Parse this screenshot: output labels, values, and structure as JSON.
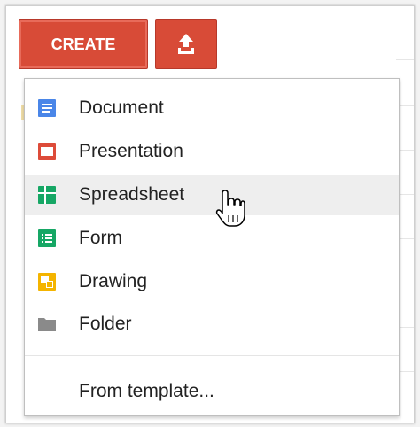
{
  "toolbar": {
    "create_label": "CREATE",
    "upload_icon": "upload-icon",
    "accent_color": "#d84b37"
  },
  "menu": {
    "items": [
      {
        "label": "Document",
        "icon": "document-icon",
        "color": "#4a86e8"
      },
      {
        "label": "Presentation",
        "icon": "presentation-icon",
        "color": "#dd4b39"
      },
      {
        "label": "Spreadsheet",
        "icon": "spreadsheet-icon",
        "color": "#16a765",
        "state": "hovered"
      },
      {
        "label": "Form",
        "icon": "form-icon",
        "color": "#16a765"
      },
      {
        "label": "Drawing",
        "icon": "drawing-icon",
        "color": "#f4b400"
      },
      {
        "label": "Folder",
        "icon": "folder-icon",
        "color": "#8a8a8a"
      }
    ],
    "from_template_label": "From template..."
  },
  "pointer": "hand-pointer-icon"
}
